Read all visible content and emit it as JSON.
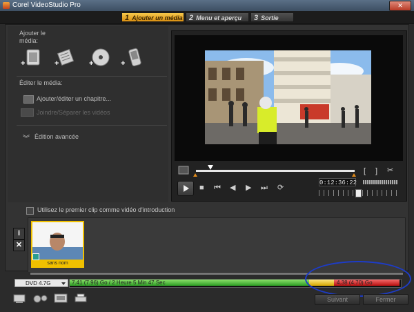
{
  "app": {
    "title": "Corel VideoStudio Pro"
  },
  "steps": [
    {
      "num": "1",
      "label": "Ajouter un média"
    },
    {
      "num": "2",
      "label": "Menu et aperçu"
    },
    {
      "num": "3",
      "label": "Sortie"
    }
  ],
  "left": {
    "add_media_title": "Ajouter le média:",
    "edit_media_title": "Éditer le média:",
    "add_edit_chapter": "Ajouter/éditer un chapitre...",
    "join_split": "Joindre/Séparer les vidéos",
    "advanced_edit": "Édition avancée"
  },
  "player": {
    "timecode": "0:12:36:22"
  },
  "intro_label": "Utilisez le premier clip comme vidéo d'introduction",
  "clip": {
    "label": "sans nom"
  },
  "capacity": {
    "disc": "DVD 4.7G",
    "used_text": "7.41 (7.96) Go / 2 Heure 5 Min 47 Sec",
    "over_text": "4.38 (4.70) Go"
  },
  "buttons": {
    "next": "Suivant",
    "close": "Fermer"
  }
}
